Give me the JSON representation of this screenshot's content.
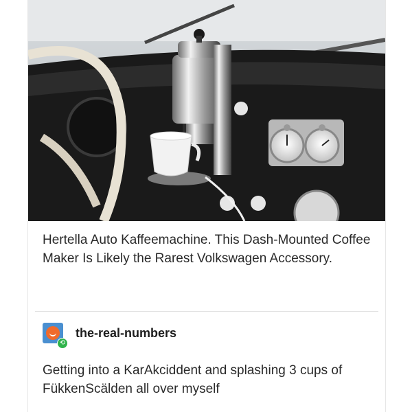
{
  "post": {
    "caption": "Hertella Auto Kaffeemachine. This Dash-Mounted Coffee Maker Is Likely the Rarest Volkswagen Accessory.",
    "photo_subject": "dash-mounted chrome coffee maker in a vintage Volkswagen"
  },
  "reblog": {
    "username": "the-real-numbers",
    "text": "Getting into a KarAkciddent and splashing 3 cups of FükkenScälden all over myself",
    "avatar_color": "#4a8fd0",
    "badge_icon": "reblog-icon",
    "badge_color": "#2fb34a"
  }
}
